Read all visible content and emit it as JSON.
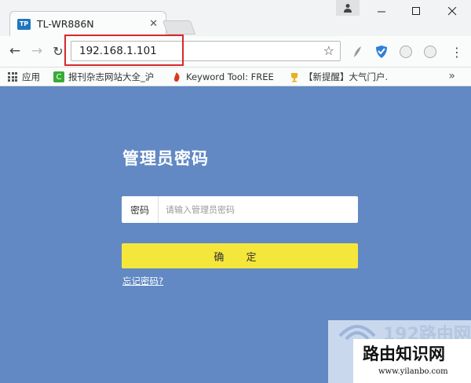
{
  "browser": {
    "tab_title": "TL-WR886N",
    "tab_favicon": "TP",
    "url": "192.168.1.101",
    "bookmarks": [
      {
        "label": "应用",
        "icon": "apps-grid-icon"
      },
      {
        "label": "报刊杂志网站大全_沪",
        "icon": "green-c-icon"
      },
      {
        "label": "Keyword Tool: FREE",
        "icon": "flame-icon"
      },
      {
        "label": "【新提醒】大气门户.",
        "icon": "trophy-icon"
      }
    ]
  },
  "login": {
    "title": "管理员密码",
    "password_label": "密码",
    "password_placeholder": "请输入管理员密码",
    "confirm_label": "确 定",
    "forgot_link": "忘记密码?"
  },
  "watermark": {
    "brand_number": "192路由网",
    "site_name": "路由知识网",
    "site_url": "www.yilanbo.com"
  },
  "colors": {
    "page_background": "#6289c4",
    "confirm_button": "#f5e63b",
    "highlight_box": "#d7282b",
    "tab_favicon": "#1f76bd"
  }
}
